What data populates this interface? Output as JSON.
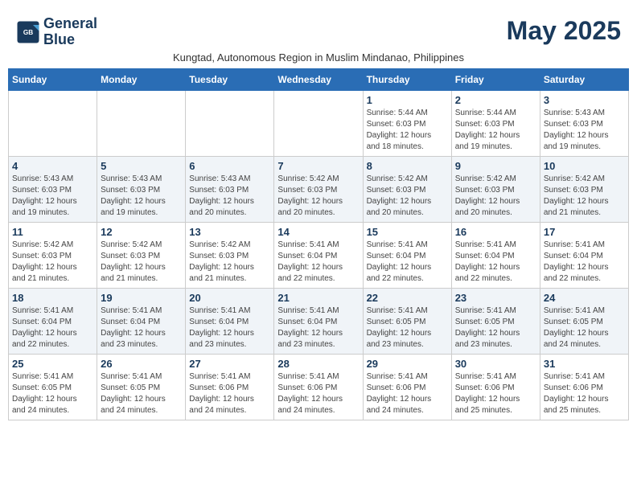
{
  "header": {
    "logo_line1": "General",
    "logo_line2": "Blue",
    "month_title": "May 2025",
    "subtitle": "Kungtad, Autonomous Region in Muslim Mindanao, Philippines"
  },
  "days_of_week": [
    "Sunday",
    "Monday",
    "Tuesday",
    "Wednesday",
    "Thursday",
    "Friday",
    "Saturday"
  ],
  "weeks": [
    [
      {
        "day": "",
        "info": ""
      },
      {
        "day": "",
        "info": ""
      },
      {
        "day": "",
        "info": ""
      },
      {
        "day": "",
        "info": ""
      },
      {
        "day": "1",
        "info": "Sunrise: 5:44 AM\nSunset: 6:03 PM\nDaylight: 12 hours\nand 18 minutes."
      },
      {
        "day": "2",
        "info": "Sunrise: 5:44 AM\nSunset: 6:03 PM\nDaylight: 12 hours\nand 19 minutes."
      },
      {
        "day": "3",
        "info": "Sunrise: 5:43 AM\nSunset: 6:03 PM\nDaylight: 12 hours\nand 19 minutes."
      }
    ],
    [
      {
        "day": "4",
        "info": "Sunrise: 5:43 AM\nSunset: 6:03 PM\nDaylight: 12 hours\nand 19 minutes."
      },
      {
        "day": "5",
        "info": "Sunrise: 5:43 AM\nSunset: 6:03 PM\nDaylight: 12 hours\nand 19 minutes."
      },
      {
        "day": "6",
        "info": "Sunrise: 5:43 AM\nSunset: 6:03 PM\nDaylight: 12 hours\nand 20 minutes."
      },
      {
        "day": "7",
        "info": "Sunrise: 5:42 AM\nSunset: 6:03 PM\nDaylight: 12 hours\nand 20 minutes."
      },
      {
        "day": "8",
        "info": "Sunrise: 5:42 AM\nSunset: 6:03 PM\nDaylight: 12 hours\nand 20 minutes."
      },
      {
        "day": "9",
        "info": "Sunrise: 5:42 AM\nSunset: 6:03 PM\nDaylight: 12 hours\nand 20 minutes."
      },
      {
        "day": "10",
        "info": "Sunrise: 5:42 AM\nSunset: 6:03 PM\nDaylight: 12 hours\nand 21 minutes."
      }
    ],
    [
      {
        "day": "11",
        "info": "Sunrise: 5:42 AM\nSunset: 6:03 PM\nDaylight: 12 hours\nand 21 minutes."
      },
      {
        "day": "12",
        "info": "Sunrise: 5:42 AM\nSunset: 6:03 PM\nDaylight: 12 hours\nand 21 minutes."
      },
      {
        "day": "13",
        "info": "Sunrise: 5:42 AM\nSunset: 6:03 PM\nDaylight: 12 hours\nand 21 minutes."
      },
      {
        "day": "14",
        "info": "Sunrise: 5:41 AM\nSunset: 6:04 PM\nDaylight: 12 hours\nand 22 minutes."
      },
      {
        "day": "15",
        "info": "Sunrise: 5:41 AM\nSunset: 6:04 PM\nDaylight: 12 hours\nand 22 minutes."
      },
      {
        "day": "16",
        "info": "Sunrise: 5:41 AM\nSunset: 6:04 PM\nDaylight: 12 hours\nand 22 minutes."
      },
      {
        "day": "17",
        "info": "Sunrise: 5:41 AM\nSunset: 6:04 PM\nDaylight: 12 hours\nand 22 minutes."
      }
    ],
    [
      {
        "day": "18",
        "info": "Sunrise: 5:41 AM\nSunset: 6:04 PM\nDaylight: 12 hours\nand 22 minutes."
      },
      {
        "day": "19",
        "info": "Sunrise: 5:41 AM\nSunset: 6:04 PM\nDaylight: 12 hours\nand 23 minutes."
      },
      {
        "day": "20",
        "info": "Sunrise: 5:41 AM\nSunset: 6:04 PM\nDaylight: 12 hours\nand 23 minutes."
      },
      {
        "day": "21",
        "info": "Sunrise: 5:41 AM\nSunset: 6:04 PM\nDaylight: 12 hours\nand 23 minutes."
      },
      {
        "day": "22",
        "info": "Sunrise: 5:41 AM\nSunset: 6:05 PM\nDaylight: 12 hours\nand 23 minutes."
      },
      {
        "day": "23",
        "info": "Sunrise: 5:41 AM\nSunset: 6:05 PM\nDaylight: 12 hours\nand 23 minutes."
      },
      {
        "day": "24",
        "info": "Sunrise: 5:41 AM\nSunset: 6:05 PM\nDaylight: 12 hours\nand 24 minutes."
      }
    ],
    [
      {
        "day": "25",
        "info": "Sunrise: 5:41 AM\nSunset: 6:05 PM\nDaylight: 12 hours\nand 24 minutes."
      },
      {
        "day": "26",
        "info": "Sunrise: 5:41 AM\nSunset: 6:05 PM\nDaylight: 12 hours\nand 24 minutes."
      },
      {
        "day": "27",
        "info": "Sunrise: 5:41 AM\nSunset: 6:06 PM\nDaylight: 12 hours\nand 24 minutes."
      },
      {
        "day": "28",
        "info": "Sunrise: 5:41 AM\nSunset: 6:06 PM\nDaylight: 12 hours\nand 24 minutes."
      },
      {
        "day": "29",
        "info": "Sunrise: 5:41 AM\nSunset: 6:06 PM\nDaylight: 12 hours\nand 24 minutes."
      },
      {
        "day": "30",
        "info": "Sunrise: 5:41 AM\nSunset: 6:06 PM\nDaylight: 12 hours\nand 25 minutes."
      },
      {
        "day": "31",
        "info": "Sunrise: 5:41 AM\nSunset: 6:06 PM\nDaylight: 12 hours\nand 25 minutes."
      }
    ]
  ]
}
